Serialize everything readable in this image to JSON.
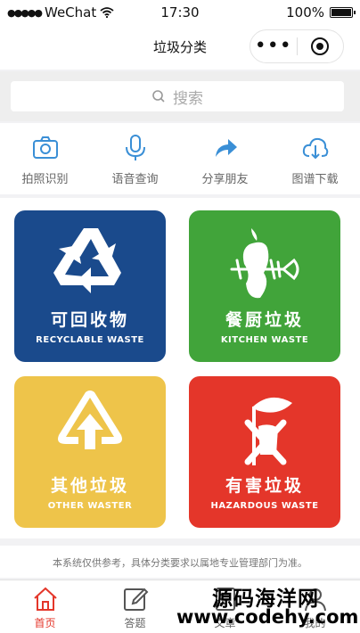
{
  "status_bar": {
    "carrier": "WeChat",
    "time": "17:30",
    "battery": "100%",
    "battery_level": 1.0
  },
  "nav": {
    "title": "垃圾分类"
  },
  "search": {
    "placeholder": "搜索"
  },
  "features": [
    {
      "label": "拍照识别",
      "icon": "camera-icon"
    },
    {
      "label": "语音查询",
      "icon": "microphone-icon"
    },
    {
      "label": "分享朋友",
      "icon": "share-arrow-icon"
    },
    {
      "label": "图谱下载",
      "icon": "cloud-download-icon"
    }
  ],
  "categories": [
    {
      "cn": "可回收物",
      "en": "RECYCLABLE WASTE",
      "color": "#1a4a8c",
      "icon": "recycle-icon"
    },
    {
      "cn": "餐厨垃圾",
      "en": "KITCHEN WASTE",
      "color": "#41a43a",
      "icon": "fishbone-apple-icon"
    },
    {
      "cn": "其他垃圾",
      "en": "OTHER WASTER",
      "color": "#eec44a",
      "icon": "other-waste-icon"
    },
    {
      "cn": "有害垃圾",
      "en": "HAZARDOUS WASTE",
      "color": "#e4362a",
      "icon": "hazardous-icon"
    }
  ],
  "disclaimer": "本系统仅供参考，具体分类要求以属地专业管理部门为准。",
  "tabs": [
    {
      "label": "首页",
      "icon": "home-icon",
      "active": true
    },
    {
      "label": "答题",
      "icon": "edit-icon",
      "active": false
    },
    {
      "label": "文章",
      "icon": "article-icon",
      "active": false
    },
    {
      "label": "我的",
      "icon": "user-icon",
      "active": false
    }
  ],
  "watermark": {
    "line1": "源码海洋网",
    "line2": "www.codehy.com"
  },
  "colors": {
    "accent_blue": "#3a8fd6",
    "active_red": "#e4362a"
  }
}
